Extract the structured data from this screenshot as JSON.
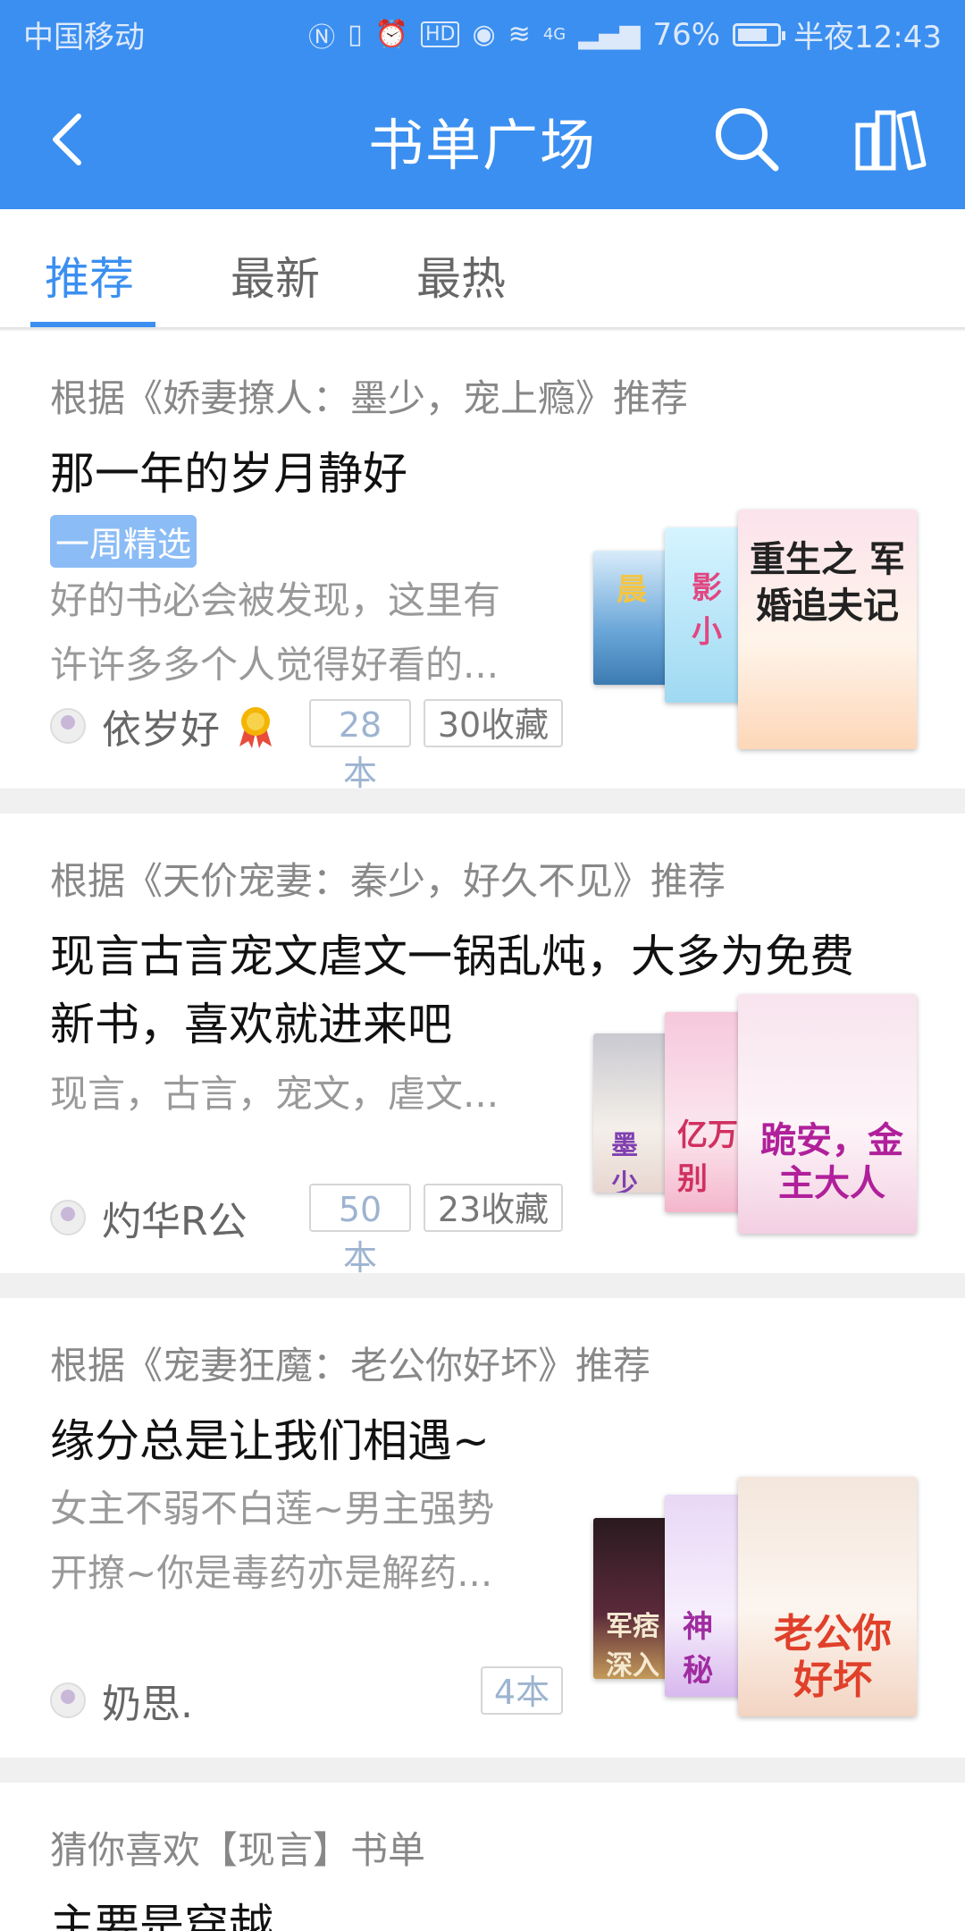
{
  "status": {
    "carrier": "中国移动",
    "net": "4G",
    "battery": "76%",
    "battery_level": 0.76,
    "time": "半夜12:43"
  },
  "header": {
    "title": "书单广场",
    "icons": [
      "back-arrow-icon",
      "search-icon",
      "bookshelf-icon"
    ]
  },
  "tabs": [
    {
      "label": "推荐",
      "active": true
    },
    {
      "label": "最新",
      "active": false
    },
    {
      "label": "最热",
      "active": false
    }
  ],
  "accent_color": "#3b8ff0",
  "cards": [
    {
      "reason": "根据《娇妻撩人：墨少，宠上瘾》推荐",
      "title": "那一年的岁月静好",
      "tag": "一周精选",
      "desc": [
        "好的书必会被发现，这里有",
        "许许多多个人觉得好看的..."
      ],
      "author": "依岁好",
      "books": "28本",
      "favorites": "30收藏",
      "covers": [
        "晨",
        "影小",
        "重生之 军婚追夫记"
      ]
    },
    {
      "reason": "根据《天价宠妻：秦少，好久不见》推荐",
      "title_lines": [
        "现言古言宠文虐文一锅乱炖，大多为免费",
        "新书，喜欢就进来吧"
      ],
      "desc": [
        "现言，古言，宠文，虐文..."
      ],
      "author": "灼华R公",
      "books": "50本",
      "favorites": "23收藏",
      "covers": [
        "墨少宠",
        "亿万别",
        "跪安，金主大人"
      ]
    },
    {
      "reason": "根据《宠妻狂魔：老公你好坏》推荐",
      "title": "缘分总是让我们相遇~",
      "desc": [
        "女主不弱不白莲~男主强势",
        "开撩~你是毒药亦是解药..."
      ],
      "author": "奶思.",
      "books": "4本",
      "covers": [
        "军痞深入",
        "神秘",
        "老公你好坏"
      ]
    },
    {
      "reason": "猜你喜欢【现言】书单",
      "title": "主要是穿越"
    }
  ]
}
